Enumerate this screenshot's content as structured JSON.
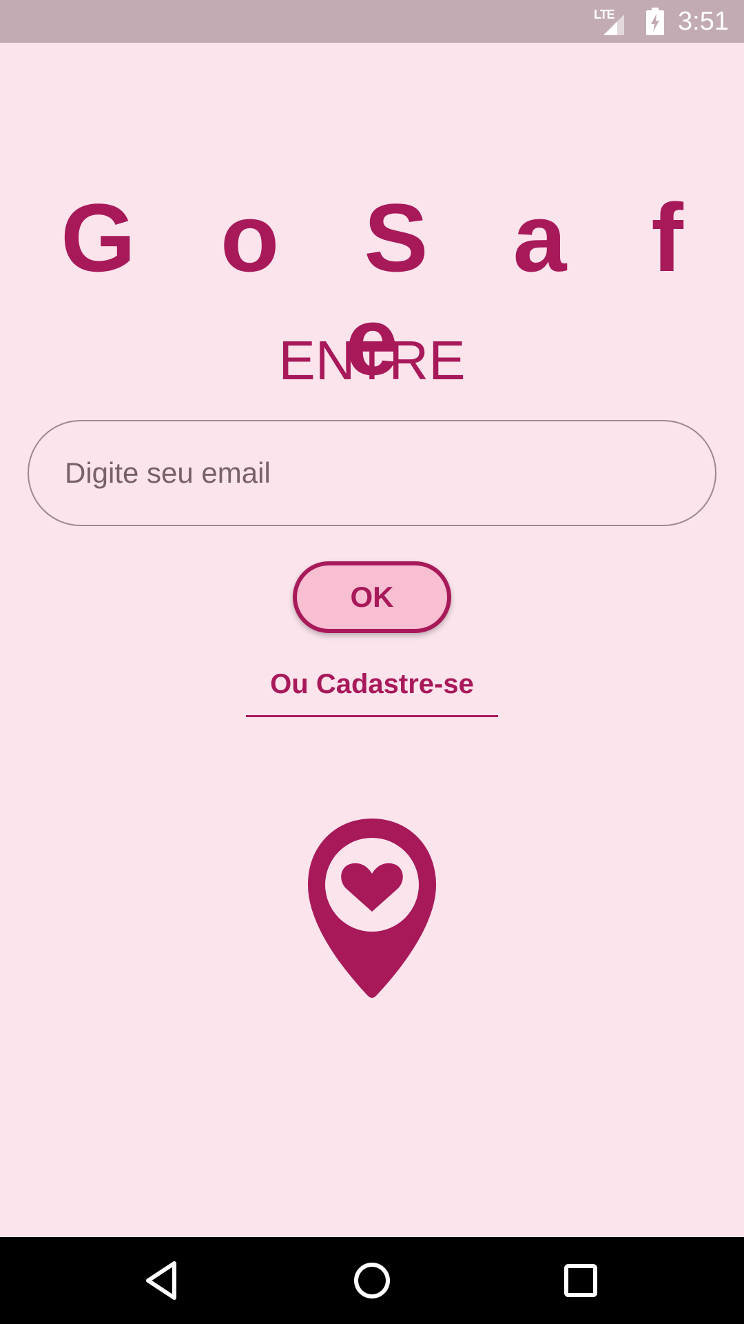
{
  "status_bar": {
    "network_label": "LTE",
    "time": "3:51",
    "icons": [
      "lte-signal-icon",
      "battery-charging-icon"
    ]
  },
  "app": {
    "title": "G o  S a f e",
    "section_title": "ENTRE"
  },
  "login": {
    "email_placeholder": "Digite seu email",
    "email_value": "",
    "ok_label": "OK",
    "signup_label": "Ou Cadastre-se"
  },
  "logo": {
    "icon": "heart-location-pin-icon"
  },
  "nav_bar": {
    "icons": [
      "back-icon",
      "home-icon",
      "recent-apps-icon"
    ]
  },
  "colors": {
    "primary": "#a8195a",
    "background": "#fbe4ec",
    "button_fill": "#f8bed2",
    "status_bar": "#c2abb2",
    "field_border": "#a2878f",
    "placeholder": "#7a6067"
  }
}
